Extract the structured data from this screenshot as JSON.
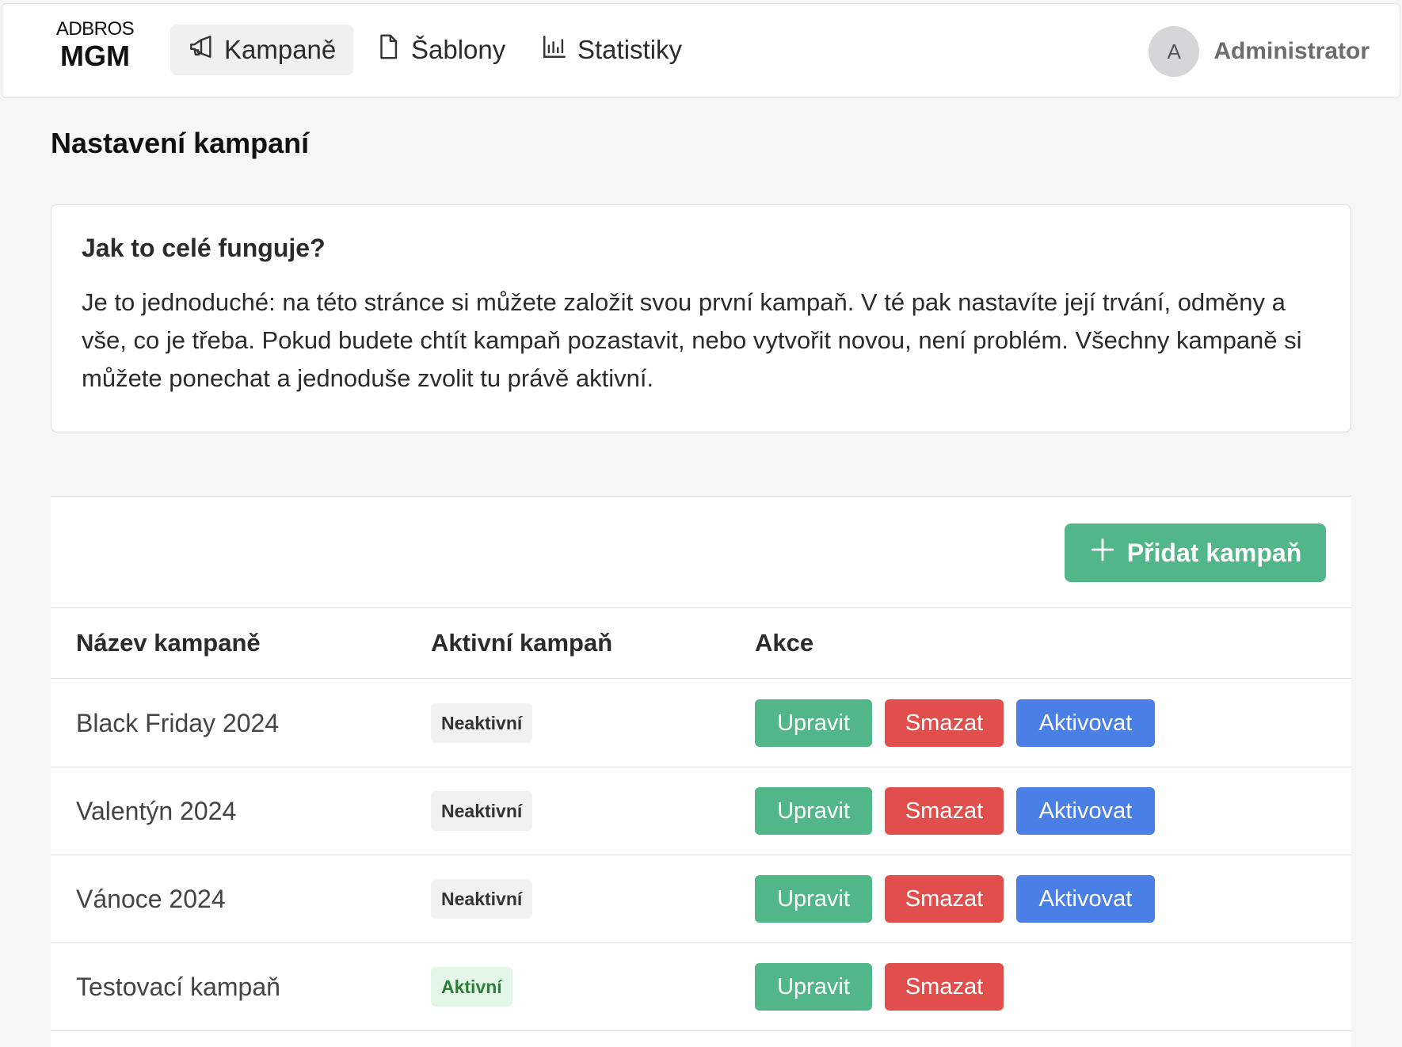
{
  "brand": {
    "top": "ADBROS",
    "bottom": "MGM"
  },
  "nav": {
    "items": [
      {
        "label": "Kampaně",
        "icon": "megaphone-icon",
        "active": true
      },
      {
        "label": "Šablony",
        "icon": "document-icon",
        "active": false
      },
      {
        "label": "Statistiky",
        "icon": "bar-chart-icon",
        "active": false
      }
    ]
  },
  "user": {
    "initial": "A",
    "name": "Administrator"
  },
  "page": {
    "title": "Nastavení kampaní"
  },
  "info": {
    "title": "Jak to celé funguje?",
    "text": "Je to jednoduché: na této stránce si můžete založit svou první kampaň. V té pak nastavíte její trvání, odměny a vše, co je třeba. Pokud budete chtít kampaň pozastavit, nebo vytvořit novou, není problém. Všechny kampaně si můžete ponechat a jednoduše zvolit tu právě aktivní."
  },
  "table": {
    "add_label": "Přidat kampaň",
    "columns": [
      "Název kampaně",
      "Aktivní kampaň",
      "Akce"
    ],
    "rows": [
      {
        "name": "Black Friday 2024",
        "status": "Neaktivní",
        "active": false
      },
      {
        "name": "Valentýn 2024",
        "status": "Neaktivní",
        "active": false
      },
      {
        "name": "Vánoce 2024",
        "status": "Neaktivní",
        "active": false
      },
      {
        "name": "Testovací kampaň",
        "status": "Aktivní",
        "active": true
      }
    ],
    "actions": {
      "edit": "Upravit",
      "delete": "Smazat",
      "activate": "Aktivovat"
    }
  },
  "colors": {
    "green": "#52b788",
    "red": "#e04f4c",
    "blue": "#4a7fe5",
    "active_badge_bg": "#e3f7e6",
    "active_badge_text": "#2f7d3b"
  }
}
